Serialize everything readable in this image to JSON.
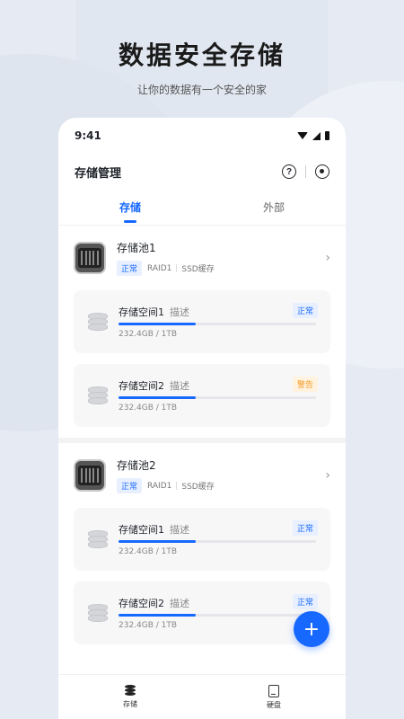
{
  "hero": {
    "title": "数据安全存储",
    "subtitle": "让你的数据有一个安全的家"
  },
  "status_bar": {
    "time": "9:41"
  },
  "header": {
    "title": "存储管理"
  },
  "tabs": [
    {
      "label": "存储",
      "active": true
    },
    {
      "label": "外部",
      "active": false
    }
  ],
  "pools": [
    {
      "name": "存储池1",
      "status": "正常",
      "raid": "RAID1",
      "cache": "SSD缓存",
      "spaces": [
        {
          "name": "存储空间1",
          "desc": "描述",
          "size": "232.4GB / 1TB",
          "usage": 0.39,
          "status": "正常",
          "status_kind": "normal"
        },
        {
          "name": "存储空间2",
          "desc": "描述",
          "size": "232.4GB / 1TB",
          "usage": 0.39,
          "status": "警告",
          "status_kind": "warn"
        }
      ]
    },
    {
      "name": "存储池2",
      "status": "正常",
      "raid": "RAID1",
      "cache": "SSD缓存",
      "spaces": [
        {
          "name": "存储空间1",
          "desc": "描述",
          "size": "232.4GB / 1TB",
          "usage": 0.39,
          "status": "正常",
          "status_kind": "normal"
        },
        {
          "name": "存储空间2",
          "desc": "描述",
          "size": "232.4GB / 1TB",
          "usage": 0.39,
          "status": "正常",
          "status_kind": "normal"
        }
      ]
    }
  ],
  "bottom_nav": [
    {
      "label": "存储",
      "icon": "database-icon"
    },
    {
      "label": "硬盘",
      "icon": "hard-drive-icon"
    }
  ],
  "fab": {
    "label": "+"
  },
  "colors": {
    "accent": "#1768ff",
    "warn": "#f59a23"
  }
}
